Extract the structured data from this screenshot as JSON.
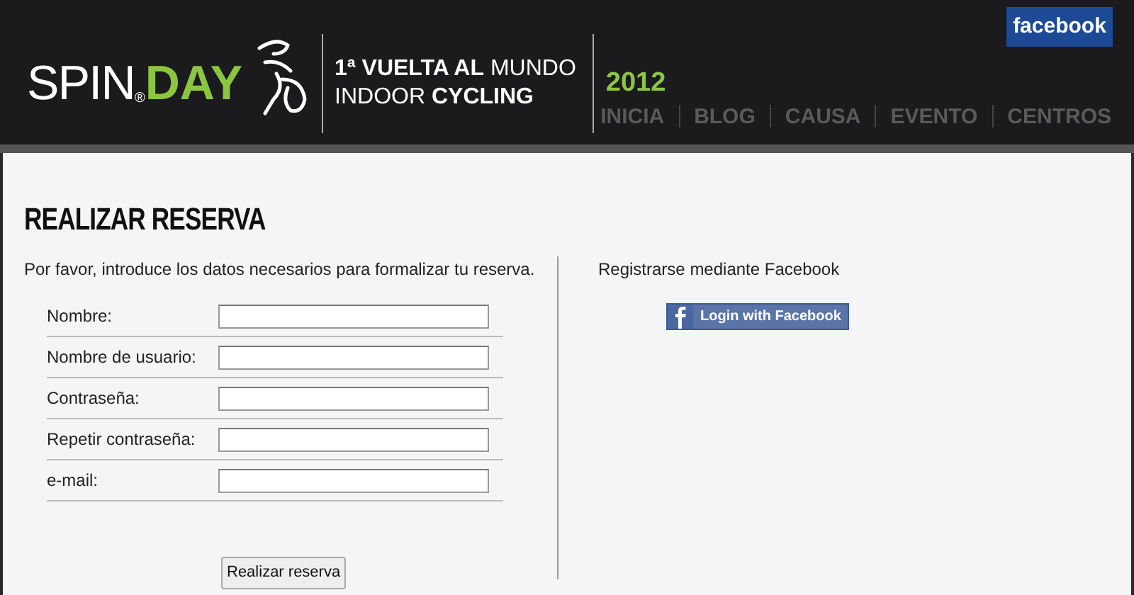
{
  "header": {
    "logo": {
      "spin": "SPIN",
      "day": "DAY",
      "registered": "®",
      "line_1": "**1ª VUELTA AL** MUNDO",
      "line_2": "INDOOR **CYCLING**",
      "year": "2012"
    },
    "facebook_badge": "facebook",
    "nav": [
      "INICIA",
      "BLOG",
      "CAUSA",
      "EVENTO",
      "CENTROS"
    ]
  },
  "title": "REALIZAR RESERVA",
  "intro": "Por favor, introduce los datos necesarios para formalizar tu reserva.",
  "fields": [
    {
      "label": "Nombre:"
    },
    {
      "label": "Nombre de usuario:"
    },
    {
      "label": "Contraseña:"
    },
    {
      "label": "Repetir contraseña:"
    },
    {
      "label": "e-mail:"
    }
  ],
  "submit": "Realizar reserva",
  "facebook": {
    "heading": "Registrarse mediante Facebook",
    "button": "Login with Facebook"
  }
}
